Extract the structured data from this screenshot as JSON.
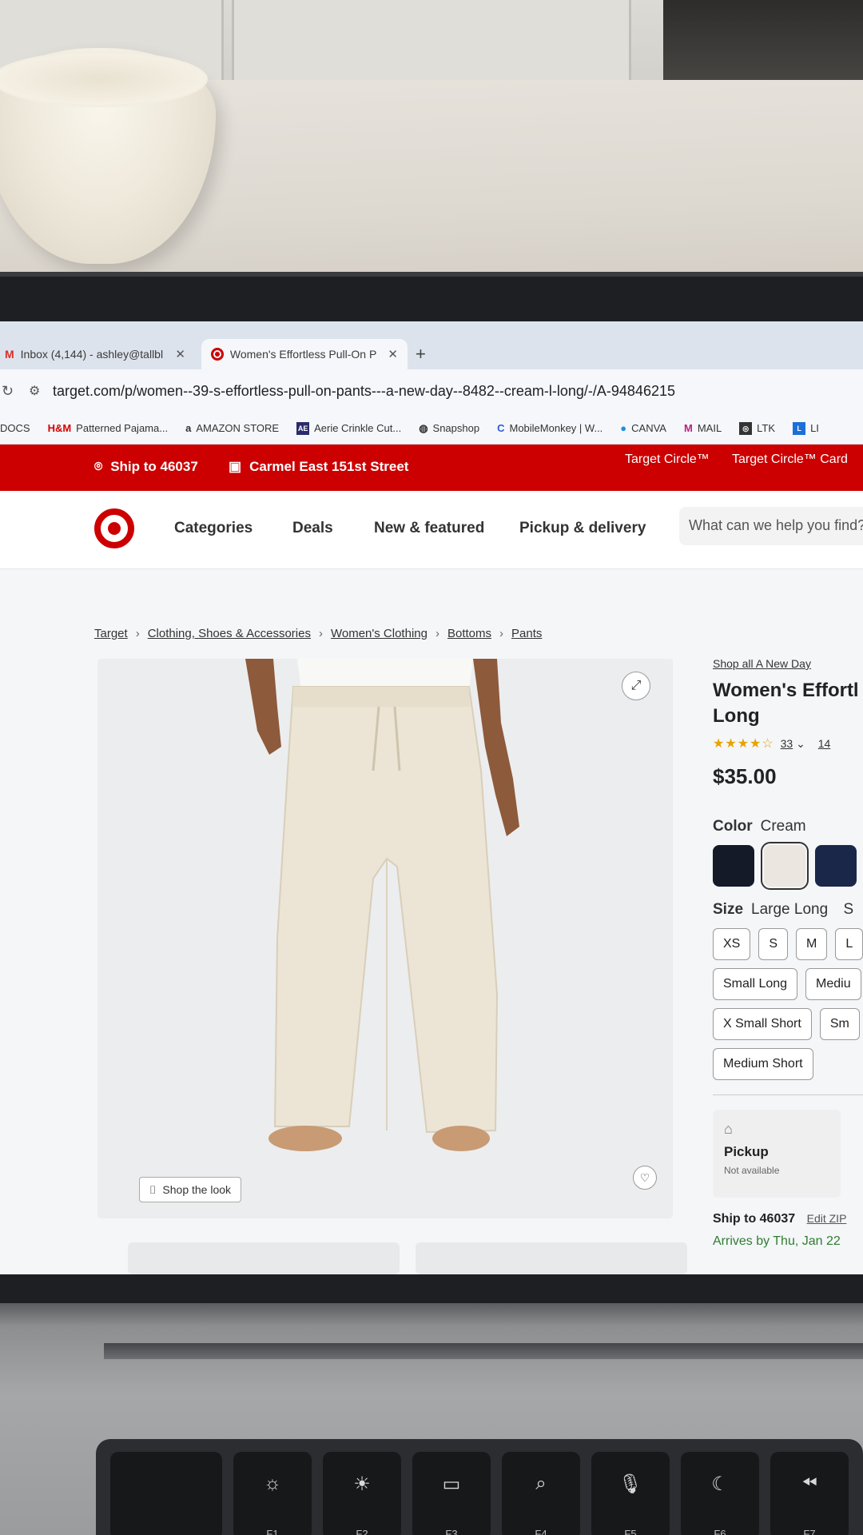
{
  "browser": {
    "tabs": [
      {
        "label": "Inbox (4,144) - ashley@tallbl",
        "icon": "gmail-icon"
      },
      {
        "label": "Women's Effortless Pull-On P",
        "icon": "target-icon"
      }
    ],
    "url": "target.com/p/women--39-s-effortless-pull-on-pants---a-new-day--8482--cream-l-long/-/A-94846215",
    "bookmarks": [
      "DOCS",
      "Patterned Pajama...",
      "AMAZON STORE",
      "Aerie Crinkle Cut...",
      "Snapshop",
      "MobileMonkey | W...",
      "CANVA",
      "MAIL",
      "LTK",
      "LI"
    ]
  },
  "site": {
    "ship_to": "Ship to 46037",
    "store": "Carmel East 151st Street",
    "circle": "Target Circle™",
    "circle_card": "Target Circle™ Card",
    "nav": [
      "Categories",
      "Deals",
      "New & featured",
      "Pickup & delivery"
    ],
    "search_placeholder": "What can we help you find?"
  },
  "breadcrumb": [
    "Target",
    "Clothing, Shoes & Accessories",
    "Women's Clothing",
    "Bottoms",
    "Pants"
  ],
  "product": {
    "shop_all": "Shop all A New Day",
    "title_line1": "Women's Effortl",
    "title_line2": "Long",
    "rating": 3.5,
    "stars": "★★★★☆",
    "review_count": "33",
    "extra_count": "14",
    "price": "$35.00",
    "color_label": "Color",
    "color_value": "Cream",
    "swatch_colors": [
      "#141a28",
      "#ebe6df",
      "#1a2748"
    ],
    "size_label": "Size",
    "size_value": "Large Long",
    "size_value_extra": "S",
    "sizes": [
      "XS",
      "S",
      "M",
      "L",
      "Small Long",
      "Mediu",
      "X Small Short",
      "Sm",
      "Medium Short"
    ],
    "shop_the_look": "Shop the look",
    "pickup_label": "Pickup",
    "pickup_status": "Not available",
    "ship_to": "Ship to 46037",
    "edit_zip": "Edit ZIP",
    "arrives": "Arrives by Thu, Jan 22"
  },
  "keyboard": {
    "keys": [
      "",
      "F1",
      "F2",
      "F3",
      "F4",
      "F5",
      "F6",
      "F7"
    ]
  }
}
